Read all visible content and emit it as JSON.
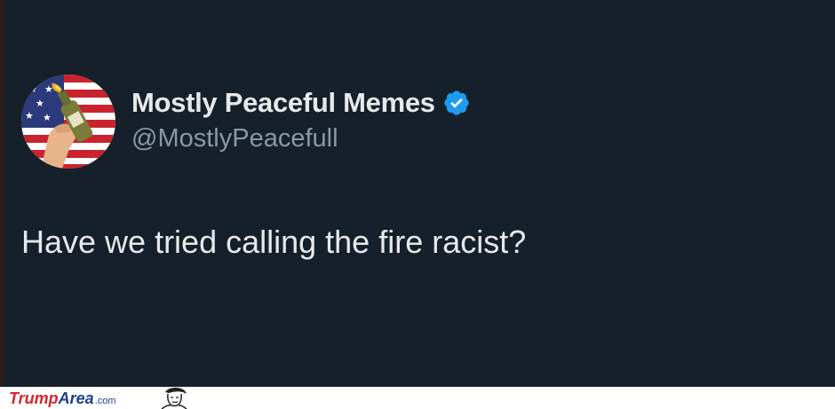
{
  "tweet": {
    "display_name": "Mostly Peaceful Memes",
    "handle": "@MostlyPeacefull",
    "text": "Have we tried calling the fire racist?",
    "verified": true,
    "verified_badge_icon": "verified-badge-icon",
    "avatar_icon": "molotov-flag-avatar",
    "colors": {
      "background": "#15202b",
      "name": "#e7e9ea",
      "handle": "#8b98a5",
      "text": "#e7e9ea",
      "verified": "#1d9bf0"
    }
  },
  "watermark": {
    "brand_part1": "Trump",
    "brand_part2": "Area",
    "brand_suffix": ".com",
    "colors": {
      "part1": "#d8262b",
      "part2": "#1c3f94"
    }
  }
}
